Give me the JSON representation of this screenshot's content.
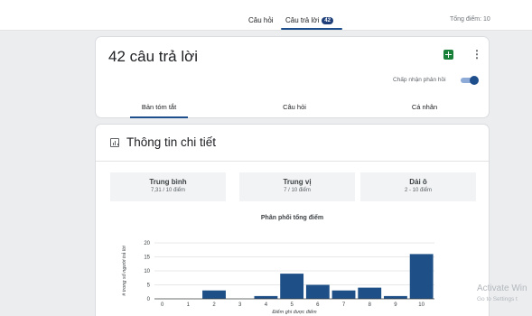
{
  "top_tabs": {
    "questions": "Câu hỏi",
    "responses": "Câu trả lời",
    "response_count": "42",
    "total_points": "Tổng điểm: 10"
  },
  "summary_card": {
    "title": "42 câu trả lời",
    "accepting_label": "Chấp nhận phản hồi",
    "accepting_enabled": true,
    "tabs": [
      "Bản tóm tắt",
      "Câu hỏi",
      "Cá nhân"
    ]
  },
  "insights": {
    "title": "Thông tin chi tiết",
    "stats": [
      {
        "label": "Trung bình",
        "value": "7,31 / 10 điểm"
      },
      {
        "label": "Trung vị",
        "value": "7 / 10 điểm"
      },
      {
        "label": "Dải ô",
        "value": "2 - 10 điểm"
      }
    ]
  },
  "colors": {
    "accent": "#1f4e8c",
    "bar": "#1e4f86",
    "sheets": "#188038"
  },
  "chart_data": {
    "type": "bar",
    "title": "Phân phối tổng điểm",
    "xlabel": "Điểm ghi được điểm",
    "ylabel": "# trong số người trả lời",
    "x_ticks": [
      0,
      1,
      2,
      3,
      4,
      5,
      6,
      7,
      8,
      9,
      10
    ],
    "y_ticks": [
      0,
      5,
      10,
      15,
      20
    ],
    "ylim": [
      0,
      20
    ],
    "xlim": [
      -0.3,
      10.5
    ],
    "grid": true,
    "categories": [
      2,
      3,
      4,
      5,
      6,
      7,
      8,
      9,
      10
    ],
    "values": [
      3,
      0,
      1,
      9,
      5,
      3,
      4,
      1,
      16
    ]
  },
  "watermark": {
    "line1": "Activate Win",
    "line2": "Go to Settings t"
  }
}
